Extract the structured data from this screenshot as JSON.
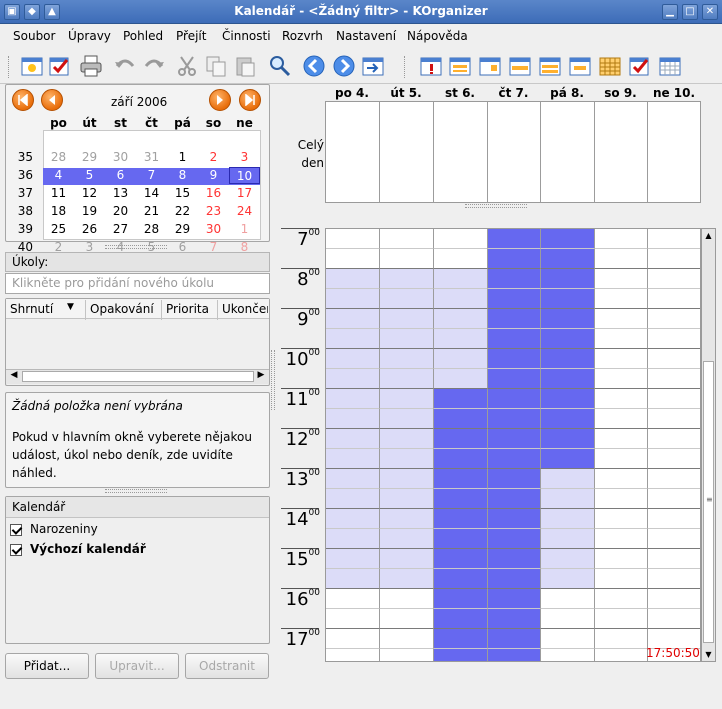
{
  "window": {
    "title": "Kalendář - <Žádný filtr> - KOrganizer"
  },
  "menu": [
    "Soubor",
    "Úpravy",
    "Pohled",
    "Přejít",
    "Činnosti",
    "Rozvrh",
    "Nastavení",
    "Nápověda"
  ],
  "toolbar_icons": [
    "new-event-icon",
    "new-todo-icon",
    "print-icon",
    "undo-icon",
    "redo-icon",
    "cut-icon",
    "copy-icon",
    "paste-icon",
    "search-icon",
    "back-icon",
    "forward-icon",
    "today-icon",
    "whats-next-icon",
    "list-view-icon",
    "day-view-icon",
    "work-week-icon",
    "week-view-icon",
    "next-x-days-icon",
    "month-view-icon",
    "todo-view-icon",
    "timeline-icon"
  ],
  "date_navigator": {
    "month_label": "září 2006",
    "weekday_headers": [
      "po",
      "út",
      "st",
      "čt",
      "pá",
      "so",
      "ne"
    ],
    "weeks": [
      {
        "no": "35",
        "days": [
          "28",
          "29",
          "30",
          "31",
          "1",
          "2",
          "3"
        ]
      },
      {
        "no": "36",
        "days": [
          "4",
          "5",
          "6",
          "7",
          "8",
          "9",
          "10"
        ]
      },
      {
        "no": "37",
        "days": [
          "11",
          "12",
          "13",
          "14",
          "15",
          "16",
          "17"
        ]
      },
      {
        "no": "38",
        "days": [
          "18",
          "19",
          "20",
          "21",
          "22",
          "23",
          "24"
        ]
      },
      {
        "no": "39",
        "days": [
          "25",
          "26",
          "27",
          "28",
          "29",
          "30",
          "1"
        ]
      },
      {
        "no": "40",
        "days": [
          "2",
          "3",
          "4",
          "5",
          "6",
          "7",
          "8"
        ]
      }
    ],
    "selected_week_index": 1,
    "colors": {
      "weekend": "#ff3333",
      "other_month": "#a0a0a0",
      "selection": "#6668f0"
    }
  },
  "todos": {
    "label": "Úkoly:",
    "placeholder": "Klikněte pro přidání nového úkolu",
    "columns": [
      "Shrnutí",
      "Opakování",
      "Priorita",
      "Ukončen"
    ]
  },
  "preview": {
    "title": "Žádná položka není vybrána",
    "body": "Pokud v hlavním okně vyberete nějakou událost, úkol nebo deník, zde uvidíte náhled."
  },
  "calendars": {
    "header": "Kalendář",
    "items": [
      {
        "name": "Narozeniny",
        "checked": true,
        "bold": false
      },
      {
        "name": "Výchozí kalendář",
        "checked": true,
        "bold": true
      }
    ]
  },
  "buttons": {
    "add": "Přidat...",
    "edit": "Upravit...",
    "remove": "Odstranit"
  },
  "agenda": {
    "day_headers": [
      "po 4.",
      "út 5.",
      "st 6.",
      "čt 7.",
      "pá 8.",
      "so 9.",
      "ne 10."
    ],
    "allday_label": [
      "Celý",
      "den"
    ],
    "hours": [
      "7",
      "8",
      "9",
      "10",
      "11",
      "12",
      "13",
      "14",
      "15",
      "16",
      "17"
    ],
    "minutes_sup": "00",
    "current_time": "17:50:50",
    "colors": {
      "busy": "#6668f0",
      "working_hours": "#dcdcf8",
      "free": "#ffffff"
    }
  }
}
